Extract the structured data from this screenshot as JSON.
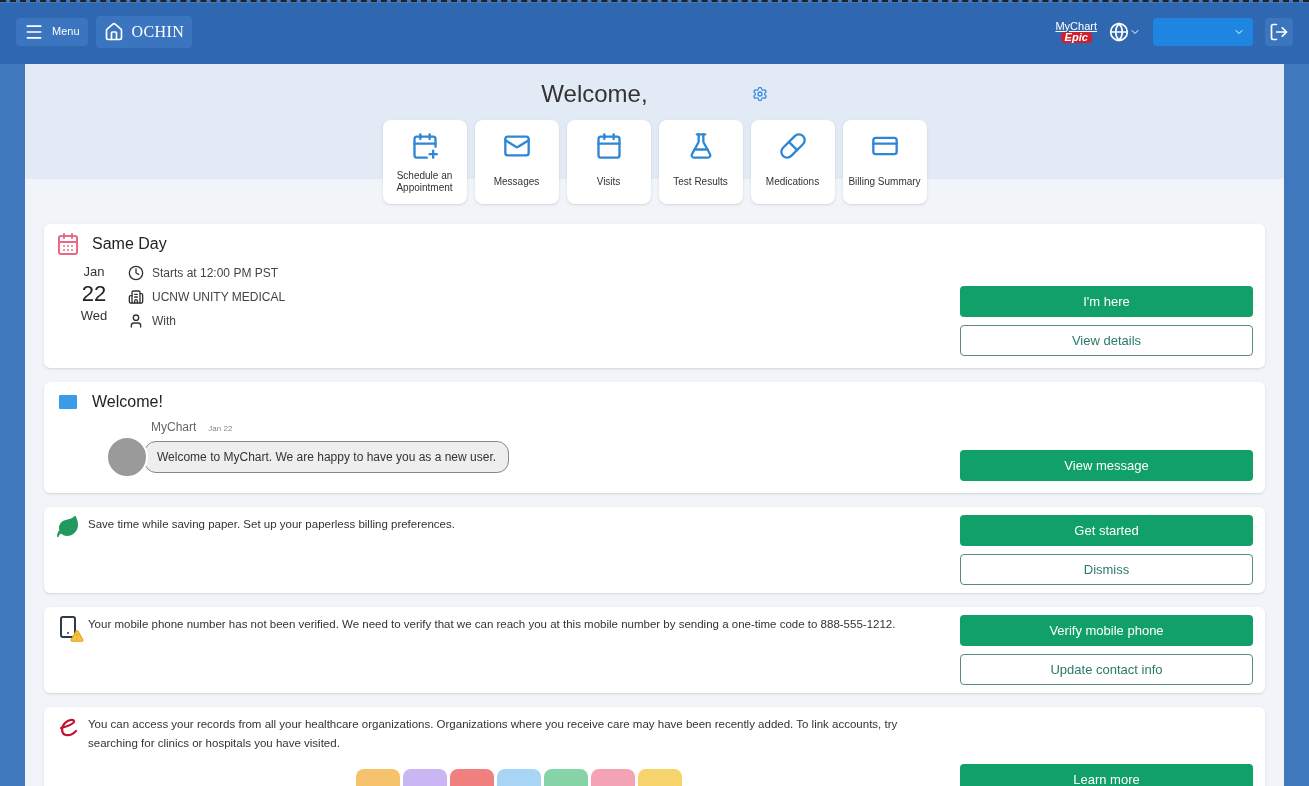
{
  "header": {
    "menu_label": "Menu",
    "brand": "OCHIN",
    "logo_top": "MyChart",
    "logo_bottom": "Epic"
  },
  "welcome": {
    "title": "Welcome,"
  },
  "quick_links": [
    {
      "label": "Schedule an Appointment"
    },
    {
      "label": "Messages"
    },
    {
      "label": "Visits"
    },
    {
      "label": "Test Results"
    },
    {
      "label": "Medications"
    },
    {
      "label": "Billing Summary"
    }
  ],
  "cards": [
    {
      "kind": "appointment",
      "title": "Same Day",
      "month": "Jan",
      "day": "22",
      "weekday": "Wed",
      "details": [
        "Starts at 12:00 PM PST",
        "UCNW UNITY MEDICAL",
        "With"
      ],
      "buttons": [
        {
          "label": "I'm here",
          "kind": "primary"
        },
        {
          "label": "View details",
          "kind": "secondary"
        }
      ]
    },
    {
      "kind": "message",
      "title": "Welcome!",
      "sender": "MyChart",
      "date": "Jan 22",
      "text": "Welcome to MyChart. We are happy to have you as a new user.",
      "buttons": [
        {
          "label": "View message",
          "kind": "primary"
        }
      ]
    },
    {
      "kind": "notice",
      "text": "Save time while saving paper. Set up your paperless billing preferences.",
      "buttons": [
        {
          "label": "Get started",
          "kind": "primary"
        },
        {
          "label": "Dismiss",
          "kind": "secondary"
        }
      ]
    },
    {
      "kind": "notice",
      "text": "Your mobile phone number has not been verified. We need to verify that we can reach you at this mobile number by sending a one-time code to 888-555-1212.",
      "buttons": [
        {
          "label": "Verify mobile phone",
          "kind": "primary"
        },
        {
          "label": "Update contact info",
          "kind": "secondary"
        }
      ]
    },
    {
      "kind": "promo",
      "text": "You can access your records from all your healthcare organizations. Organizations where you receive care may have been recently added. To link accounts, try searching for clinics or hospitals you have visited.",
      "buttons": [
        {
          "label": "Learn more",
          "kind": "primary"
        }
      ]
    }
  ]
}
